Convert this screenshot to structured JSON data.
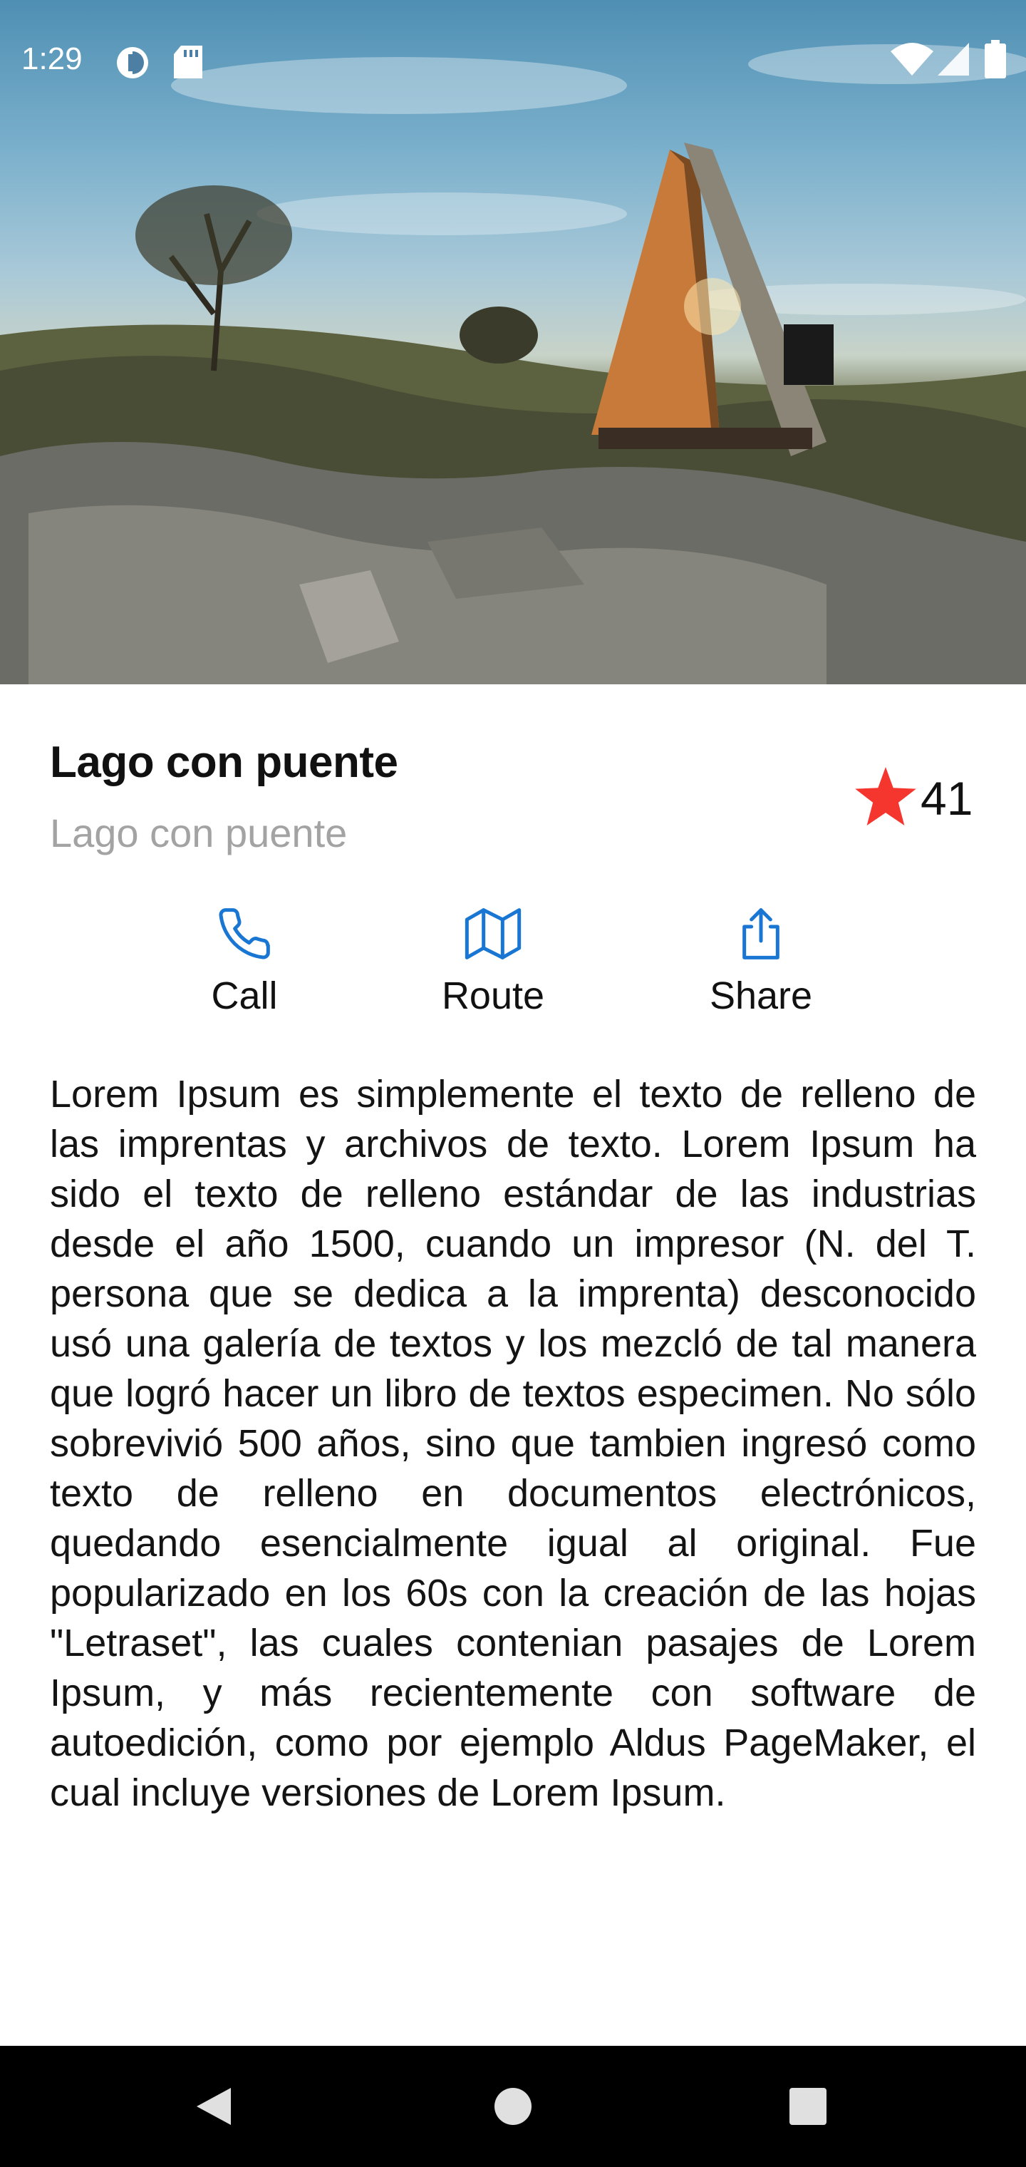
{
  "status_bar": {
    "time": "1:29",
    "icons": [
      "data-saver-icon",
      "sd-card-icon",
      "wifi-icon",
      "cellular-signal-icon",
      "battery-icon"
    ]
  },
  "hero": {
    "image_description_icon": "landscape-photo"
  },
  "place": {
    "title": "Lago con puente",
    "subtitle": "Lago con puente",
    "rating_count": "41",
    "star_color": "#f4362f"
  },
  "actions": [
    {
      "label": "Call",
      "icon": "phone-icon"
    },
    {
      "label": "Route",
      "icon": "map-icon"
    },
    {
      "label": "Share",
      "icon": "share-icon"
    }
  ],
  "accent_color": "#1976d2",
  "description": "Lorem Ipsum es simplemente el texto de relleno de las imprentas y archivos de texto. Lorem Ipsum ha sido el texto de relleno estándar de las industrias desde el año 1500, cuando un impresor (N. del T. persona que se dedica a la imprenta) desconocido usó una galería de textos y los mezcló de tal manera que logró hacer un libro de textos especimen. No sólo sobrevivió 500 años, sino que tambien ingresó como texto de relleno en documentos electrónicos, quedando esencialmente igual al original. Fue popularizado en los 60s con la creación de las hojas \"Letraset\", las cuales contenian pasajes de Lorem Ipsum, y más recientemente con software de autoedición, como por ejemplo Aldus PageMaker, el cual incluye versiones de Lorem Ipsum.",
  "nav_bar": {
    "buttons": [
      "back-icon",
      "home-icon",
      "recents-icon"
    ]
  }
}
